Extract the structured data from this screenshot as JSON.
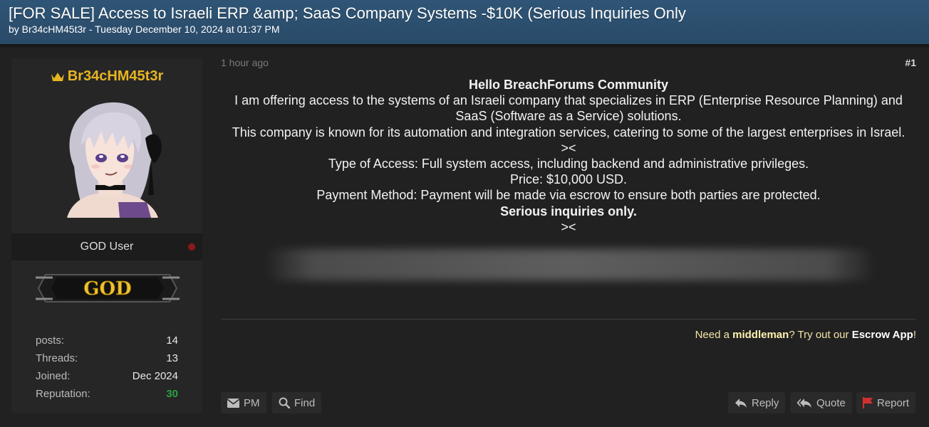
{
  "thread": {
    "title": "[FOR SALE] Access to Israeli ERP &amp; SaaS Company Systems -$10K (Serious Inquiries Only",
    "byline": "by Br34cHM45t3r - Tuesday December 10, 2024 at 01:37 PM"
  },
  "author": {
    "name": "Br34cHM45t3r",
    "rank": "GOD User",
    "badge_text": "GOD",
    "stats": [
      {
        "label": "posts:",
        "value": "14"
      },
      {
        "label": "Threads:",
        "value": "13"
      },
      {
        "label": "Joined:",
        "value": "Dec 2024"
      },
      {
        "label": "Reputation:",
        "value": "30"
      }
    ]
  },
  "post": {
    "time": "1 hour ago",
    "number": "#1",
    "lines": {
      "greeting": "Hello BreachForums Community",
      "l1": "I am offering access to the systems of an Israeli company that specializes in ERP (Enterprise Resource Planning) and SaaS (Software as a Service) solutions.",
      "l2": "This company is known for its automation and integration services, catering to some of the largest enterprises in Israel.",
      "sep1": "><",
      "l3": "Type of Access: Full system access, including backend and administrative privileges.",
      "l4": "Price: $10,000 USD.",
      "l5": "Payment Method: Payment will be made via escrow to ensure both parties are protected.",
      "l6": "Serious inquiries only.",
      "sep2": "><"
    }
  },
  "signature": {
    "pre": "Need a ",
    "middleman": "middleman",
    "mid": "? Try out our ",
    "escrow": "Escrow App",
    "post": "!"
  },
  "buttons": {
    "pm": "PM",
    "find": "Find",
    "reply": "Reply",
    "quote": "Quote",
    "report": "Report"
  },
  "colors": {
    "header_bg": "#2c4f6e",
    "username": "#e6b422",
    "reputation": "#2ea043",
    "report_flag": "#d32f2f"
  }
}
